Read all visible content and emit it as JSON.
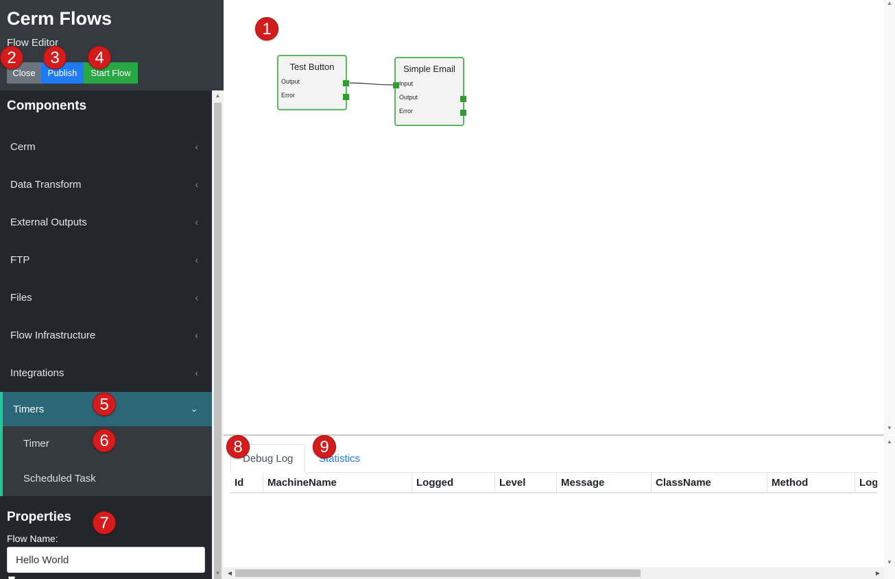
{
  "app": {
    "title": "Cerm Flows",
    "subtitle": "Flow Editor"
  },
  "header_buttons": {
    "close": "Close",
    "publish": "Publish",
    "start": "Start Flow"
  },
  "components": {
    "title": "Components",
    "categories": [
      "Cerm",
      "Data Transform",
      "External Outputs",
      "FTP",
      "Files",
      "Flow Infrastructure",
      "Integrations"
    ],
    "active_category": "Timers",
    "active_items": [
      "Timer",
      "Scheduled Task"
    ],
    "chevron_collapsed": "‹",
    "chevron_expanded": "⌄"
  },
  "properties": {
    "title": "Properties",
    "flow_name_label": "Flow Name:",
    "flow_name_value": "Hello World"
  },
  "nodes": {
    "test_button": {
      "title": "Test Button",
      "ports": [
        "Output",
        "Error"
      ]
    },
    "simple_email": {
      "title": "Simple Email",
      "input": "Input",
      "ports": [
        "Output",
        "Error"
      ]
    }
  },
  "bottom": {
    "tabs": [
      "Debug Log",
      "Statistics"
    ],
    "columns": [
      "Id",
      "MachineName",
      "Logged",
      "Level",
      "Message",
      "ClassName",
      "Method",
      "LogT"
    ]
  },
  "badges": [
    "1",
    "2",
    "3",
    "4",
    "5",
    "6",
    "7",
    "8",
    "9"
  ],
  "colors": {
    "node_border": "#5cb85c",
    "port": "#2e9e2e",
    "active_menu": "#2b6777",
    "badge": "#d41c1c",
    "publish": "#1e7bf1",
    "start": "#28a745"
  }
}
